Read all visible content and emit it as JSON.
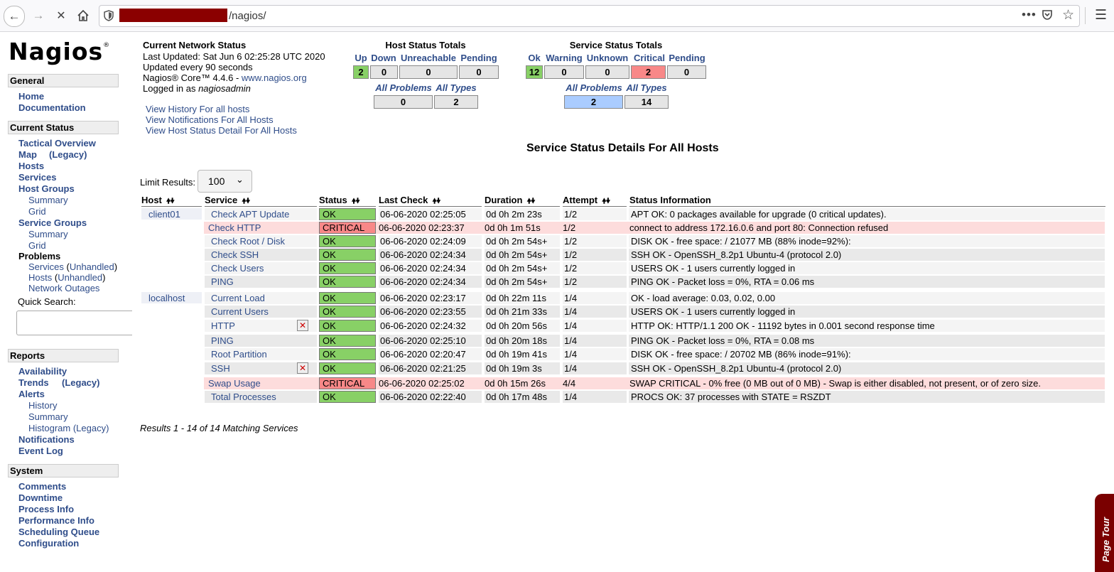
{
  "browser": {
    "url_path": "/nagios/",
    "icons": [
      "back-icon",
      "forward-icon",
      "stop-icon",
      "home-icon",
      "shield-icon",
      "more-icon",
      "pocket-icon",
      "star-icon",
      "menu-icon"
    ]
  },
  "sidebar": {
    "logo": "Nagios",
    "logo_mark": "®",
    "general": {
      "heading": "General",
      "items": [
        "Home",
        "Documentation"
      ]
    },
    "current_status": {
      "heading": "Current Status",
      "tactical": "Tactical Overview",
      "map": "Map",
      "map_legacy": "(Legacy)",
      "hosts": "Hosts",
      "services": "Services",
      "host_groups": "Host Groups",
      "hg_summary": "Summary",
      "hg_grid": "Grid",
      "service_groups": "Service Groups",
      "sg_summary": "Summary",
      "sg_grid": "Grid",
      "problems": "Problems",
      "prob_services": "Services",
      "prob_services_unhandled": "Unhandled",
      "prob_hosts": "Hosts",
      "prob_hosts_unhandled": "Unhandled",
      "network_outages": "Network Outages",
      "quick_search": "Quick Search:"
    },
    "reports": {
      "heading": "Reports",
      "availability": "Availability",
      "trends": "Trends",
      "trends_legacy": "(Legacy)",
      "alerts": "Alerts",
      "history": "History",
      "summary": "Summary",
      "histogram": "Histogram (Legacy)",
      "notifications": "Notifications",
      "event_log": "Event Log"
    },
    "system": {
      "heading": "System",
      "items": [
        "Comments",
        "Downtime",
        "Process Info",
        "Performance Info",
        "Scheduling Queue",
        "Configuration"
      ]
    }
  },
  "network_status": {
    "title": "Current Network Status",
    "last_updated": "Last Updated: Sat Jun 6 02:25:28 UTC 2020",
    "update_interval": "Updated every 90 seconds",
    "version_prefix": "Nagios® Core™ 4.4.6 - ",
    "version_link": "www.nagios.org",
    "logged_in_prefix": "Logged in as ",
    "user": "nagiosadmin",
    "links": [
      "View History For all hosts",
      "View Notifications For All Hosts",
      "View Host Status Detail For All Hosts"
    ]
  },
  "host_totals": {
    "title": "Host Status Totals",
    "headers": [
      "Up",
      "Down",
      "Unreachable",
      "Pending"
    ],
    "values": [
      "2",
      "0",
      "0",
      "0"
    ],
    "sub_headers": [
      "All Problems",
      "All Types"
    ],
    "sub_values": [
      "0",
      "2"
    ]
  },
  "service_totals": {
    "title": "Service Status Totals",
    "headers": [
      "Ok",
      "Warning",
      "Unknown",
      "Critical",
      "Pending"
    ],
    "values": [
      "12",
      "0",
      "0",
      "2",
      "0"
    ],
    "sub_headers": [
      "All Problems",
      "All Types"
    ],
    "sub_values": [
      "2",
      "14"
    ]
  },
  "colors": {
    "ok": "#88d066",
    "critical": "#f88888",
    "critical_row": "#fddcdc",
    "link": "#2f4d8a",
    "problems_highlight": "#aaccff",
    "tour": "#7a0000"
  },
  "details": {
    "title": "Service Status Details For All Hosts",
    "limit_label": "Limit Results:",
    "limit_value": "100",
    "columns": [
      "Host",
      "Service",
      "Status",
      "Last Check",
      "Duration",
      "Attempt",
      "Status Information"
    ],
    "sort_glyph": "🠝🠟",
    "rows": [
      {
        "host": "client01",
        "service": "Check APT Update",
        "status": "OK",
        "last_check": "06-06-2020 02:25:05",
        "duration": "0d 0h 2m 23s",
        "attempt": "1/2",
        "info": "APT OK: 0 packages available for upgrade (0 critical updates)."
      },
      {
        "host": "",
        "service": "Check HTTP",
        "status": "CRITICAL",
        "last_check": "06-06-2020 02:23:37",
        "duration": "0d 0h 1m 51s",
        "attempt": "1/2",
        "info": "connect to address 172.16.0.6 and port 80: Connection refused"
      },
      {
        "host": "",
        "service": "Check Root / Disk",
        "status": "OK",
        "last_check": "06-06-2020 02:24:09",
        "duration": "0d 0h 2m 54s+",
        "attempt": "1/2",
        "info": "DISK OK - free space: / 21077 MB (88% inode=92%):"
      },
      {
        "host": "",
        "service": "Check SSH",
        "status": "OK",
        "last_check": "06-06-2020 02:24:34",
        "duration": "0d 0h 2m 54s+",
        "attempt": "1/2",
        "info": "SSH OK - OpenSSH_8.2p1 Ubuntu-4 (protocol 2.0)"
      },
      {
        "host": "",
        "service": "Check Users",
        "status": "OK",
        "last_check": "06-06-2020 02:24:34",
        "duration": "0d 0h 2m 54s+",
        "attempt": "1/2",
        "info": "USERS OK - 1 users currently logged in"
      },
      {
        "host": "",
        "service": "PING",
        "status": "OK",
        "last_check": "06-06-2020 02:24:34",
        "duration": "0d 0h 2m 54s+",
        "attempt": "1/2",
        "info": "PING OK - Packet loss = 0%, RTA = 0.06 ms"
      },
      {
        "host": "localhost",
        "service": "Current Load",
        "status": "OK",
        "last_check": "06-06-2020 02:23:17",
        "duration": "0d 0h 22m 11s",
        "attempt": "1/4",
        "info": "OK - load average: 0.03, 0.02, 0.00"
      },
      {
        "host": "",
        "service": "Current Users",
        "status": "OK",
        "last_check": "06-06-2020 02:23:55",
        "duration": "0d 0h 21m 33s",
        "attempt": "1/4",
        "info": "USERS OK - 1 users currently logged in"
      },
      {
        "host": "",
        "service": "HTTP",
        "status": "OK",
        "last_check": "06-06-2020 02:24:32",
        "duration": "0d 0h 20m 56s",
        "attempt": "1/4",
        "info": "HTTP OK: HTTP/1.1 200 OK - 11192 bytes in 0.001 second response time",
        "notifications_disabled": true
      },
      {
        "host": "",
        "service": "PING",
        "status": "OK",
        "last_check": "06-06-2020 02:25:10",
        "duration": "0d 0h 20m 18s",
        "attempt": "1/4",
        "info": "PING OK - Packet loss = 0%, RTA = 0.08 ms"
      },
      {
        "host": "",
        "service": "Root Partition",
        "status": "OK",
        "last_check": "06-06-2020 02:20:47",
        "duration": "0d 0h 19m 41s",
        "attempt": "1/4",
        "info": "DISK OK - free space: / 20702 MB (86% inode=91%):"
      },
      {
        "host": "",
        "service": "SSH",
        "status": "OK",
        "last_check": "06-06-2020 02:21:25",
        "duration": "0d 0h 19m 3s",
        "attempt": "1/4",
        "info": "SSH OK - OpenSSH_8.2p1 Ubuntu-4 (protocol 2.0)",
        "notifications_disabled": true
      },
      {
        "host": "",
        "service": "Swap Usage",
        "status": "CRITICAL",
        "last_check": "06-06-2020 02:25:02",
        "duration": "0d 0h 15m 26s",
        "attempt": "4/4",
        "info": "SWAP CRITICAL - 0% free (0 MB out of 0 MB) - Swap is either disabled, not present, or of zero size."
      },
      {
        "host": "",
        "service": "Total Processes",
        "status": "OK",
        "last_check": "06-06-2020 02:22:40",
        "duration": "0d 0h 17m 48s",
        "attempt": "1/4",
        "info": "PROCS OK: 37 processes with STATE = RSZDT"
      }
    ],
    "results_text": "Results 1 - 14 of 14 Matching Services"
  },
  "page_tour": "Page Tour"
}
